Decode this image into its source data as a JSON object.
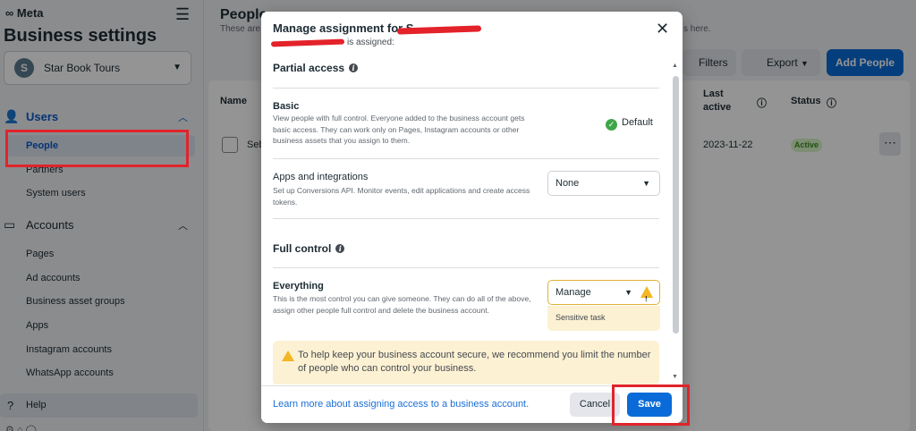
{
  "brand": "Meta",
  "app": {
    "title": "Business settings",
    "business": {
      "initial": "S",
      "name": "Star Book Tours"
    }
  },
  "sidebar": {
    "users_section": "Users",
    "users_items": [
      "People",
      "Partners",
      "System users"
    ],
    "accounts_section": "Accounts",
    "accounts_items": [
      "Pages",
      "Ad accounts",
      "Business asset groups",
      "Apps",
      "Instagram accounts",
      "WhatsApp accounts"
    ],
    "help": "Help"
  },
  "main": {
    "title": "People",
    "subtitle_start": "These are",
    "subtitle_end": "s here.",
    "filters_btn": "Filters",
    "export_btn": "Export",
    "add_people_btn": "Add People",
    "columns": {
      "name": "Name",
      "last_active": "Last active",
      "status": "Status"
    },
    "row": {
      "name_fragment": "Seb",
      "last_active": "2023-11-22",
      "status": "Active"
    }
  },
  "modal": {
    "title": "Manage assignment for S",
    "subtitle": "is assigned:",
    "partial_access": "Partial access",
    "basic": {
      "title": "Basic",
      "desc": "View people with full control. Everyone added to the business account gets basic access. They can work only on Pages, Instagram accounts or other business assets that you assign to them.",
      "badge": "Default"
    },
    "apps": {
      "title": "Apps and integrations",
      "desc": "Set up Conversions API. Monitor events, edit applications and create access tokens.",
      "value": "None"
    },
    "full_control": "Full control",
    "everything": {
      "title": "Everything",
      "desc": "This is the most control you can give someone. They can do all of the above, assign other people full control and delete the business account.",
      "value": "Manage",
      "note": "Sensitive task"
    },
    "alert": "To help keep your business account secure, we recommend you limit the number of people who can control your business.",
    "learn_more": "Learn more about assigning access to a business account.",
    "cancel": "Cancel",
    "save": "Save"
  },
  "colors": {
    "accent": "#0a6bd8",
    "annotation": "#e0242b",
    "warning": "#f3b624"
  }
}
